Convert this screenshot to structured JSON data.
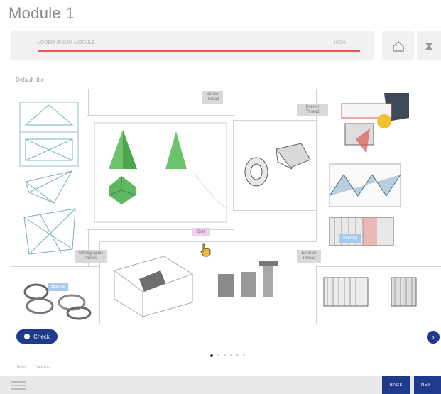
{
  "module_title": "Module 1",
  "progress": {
    "label": "LOREM IPSUM MODULE",
    "percent_label": "100%",
    "fraction": 1.0
  },
  "section_label": "Default title",
  "hotspots": {
    "screw_thread": "Screw Thread",
    "interior_thread": "Interior Thread",
    "exterior_thread": "Exterior Thread",
    "orthographic": "Orthographic Views",
    "bolt": "Bolt",
    "washers": "Washer",
    "thread_profile": "Thread",
    "internal": "Internal"
  },
  "controls": {
    "check_label": "Check",
    "next_round": "›"
  },
  "pagination": {
    "total": 6,
    "active": 0
  },
  "footer": {
    "notes": "Notes",
    "transcript": "Transcript"
  },
  "nav": {
    "back": "BACK",
    "next": "NEXT"
  },
  "colors": {
    "accent": "#1f3a8a",
    "progress": "#e35b4f",
    "hotspot": "#a9c9ef"
  }
}
